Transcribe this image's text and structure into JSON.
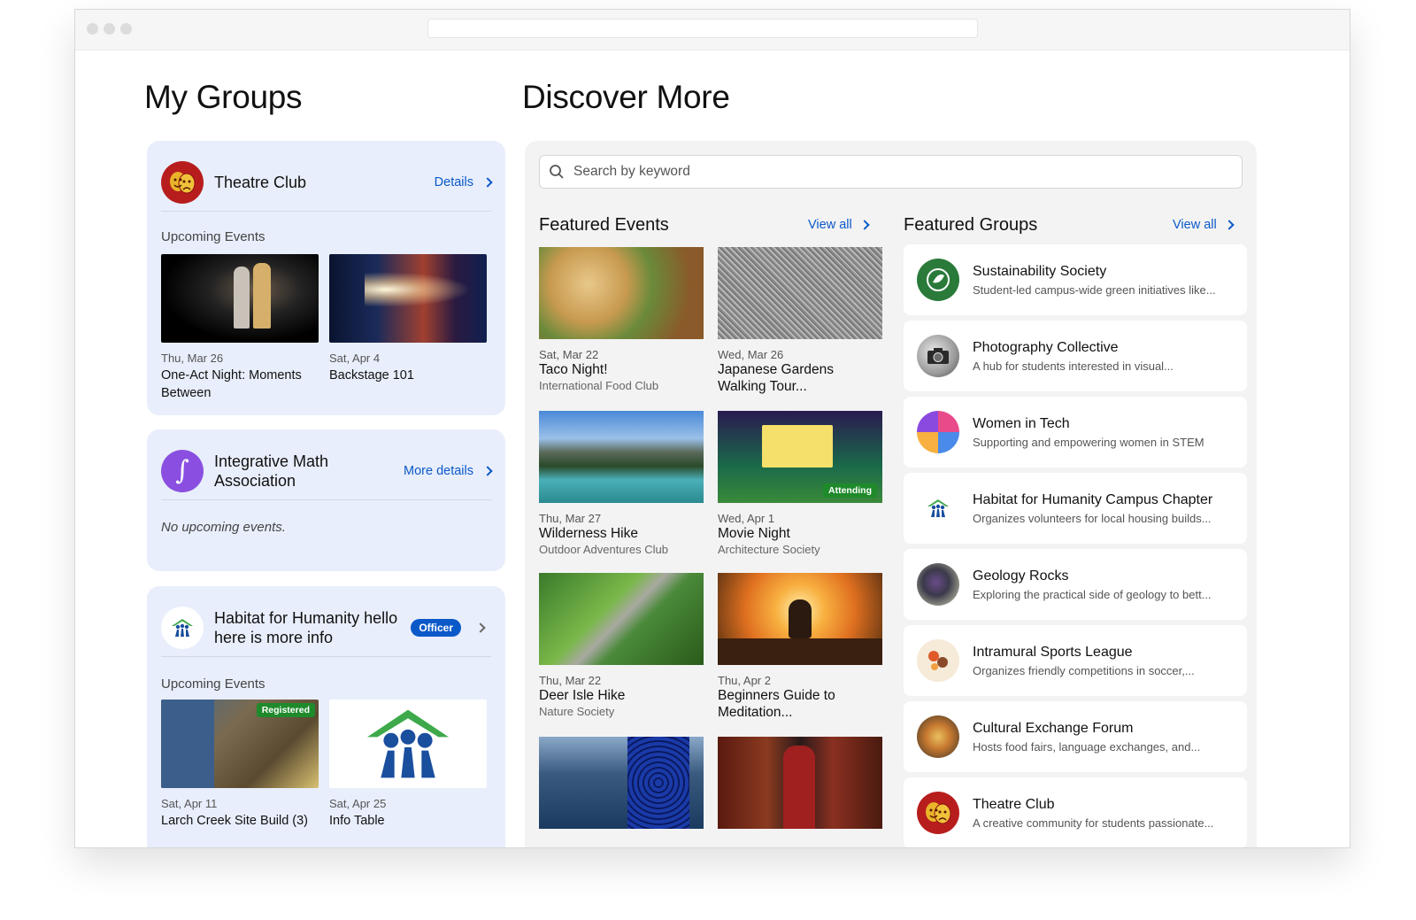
{
  "my_groups": {
    "title": "My Groups",
    "groups": [
      {
        "name": "Theatre Club",
        "link_label": "Details",
        "section_label": "Upcoming Events",
        "events": [
          {
            "date": "Thu, Mar 26",
            "title": "One-Act Night: Moments Between"
          },
          {
            "date": "Sat, Apr 4",
            "title": "Backstage 101"
          }
        ]
      },
      {
        "name": "Integrative Math Association",
        "link_label": "More details",
        "empty_text": "No upcoming events."
      },
      {
        "name": "Habitat for Humanity hello here is more info",
        "badge": "Officer",
        "section_label": "Upcoming Events",
        "events": [
          {
            "date": "Sat, Apr 11",
            "title": "Larch Creek Site Build (3)",
            "badge": "Registered"
          },
          {
            "date": "Sat, Apr 25",
            "title": "Info Table"
          }
        ]
      }
    ]
  },
  "discover": {
    "title": "Discover More",
    "search_placeholder": "Search by keyword",
    "featured_events": {
      "title": "Featured Events",
      "view_all": "View all",
      "items": [
        {
          "date": "Sat, Mar 22",
          "title": "Taco Night!",
          "org": "International Food Club"
        },
        {
          "date": "Wed, Mar 26",
          "title": "Japanese Gardens Walking Tour...",
          "org": ""
        },
        {
          "date": "Thu, Mar 27",
          "title": "Wilderness Hike",
          "org": "Outdoor Adventures Club"
        },
        {
          "date": "Wed, Apr 1",
          "title": "Movie Night",
          "org": "Architecture Society",
          "badge": "Attending"
        },
        {
          "date": "Thu, Mar 22",
          "title": "Deer Isle Hike",
          "org": "Nature Society"
        },
        {
          "date": "Thu, Apr 2",
          "title": "Beginners Guide to Meditation...",
          "org": ""
        }
      ]
    },
    "featured_groups": {
      "title": "Featured Groups",
      "view_all": "View all",
      "items": [
        {
          "name": "Sustainability Society",
          "desc": "Student-led campus-wide green initiatives like..."
        },
        {
          "name": "Photography Collective",
          "desc": "A hub for students interested in visual..."
        },
        {
          "name": "Women in Tech",
          "desc": "Supporting and empowering women in STEM"
        },
        {
          "name": "Habitat for Humanity Campus Chapter",
          "desc": "Organizes volunteers for local housing builds..."
        },
        {
          "name": "Geology Rocks",
          "desc": "Exploring the practical side of geology to bett..."
        },
        {
          "name": "Intramural Sports League",
          "desc": "Organizes friendly competitions in soccer,..."
        },
        {
          "name": "Cultural Exchange Forum",
          "desc": "Hosts food fairs, language exchanges, and..."
        },
        {
          "name": "Theatre Club",
          "desc": "A creative community for students passionate..."
        }
      ]
    }
  },
  "colors": {
    "accent": "#0b59c9",
    "card_bg": "#e8eefb",
    "status_green": "#1f8a2b"
  }
}
